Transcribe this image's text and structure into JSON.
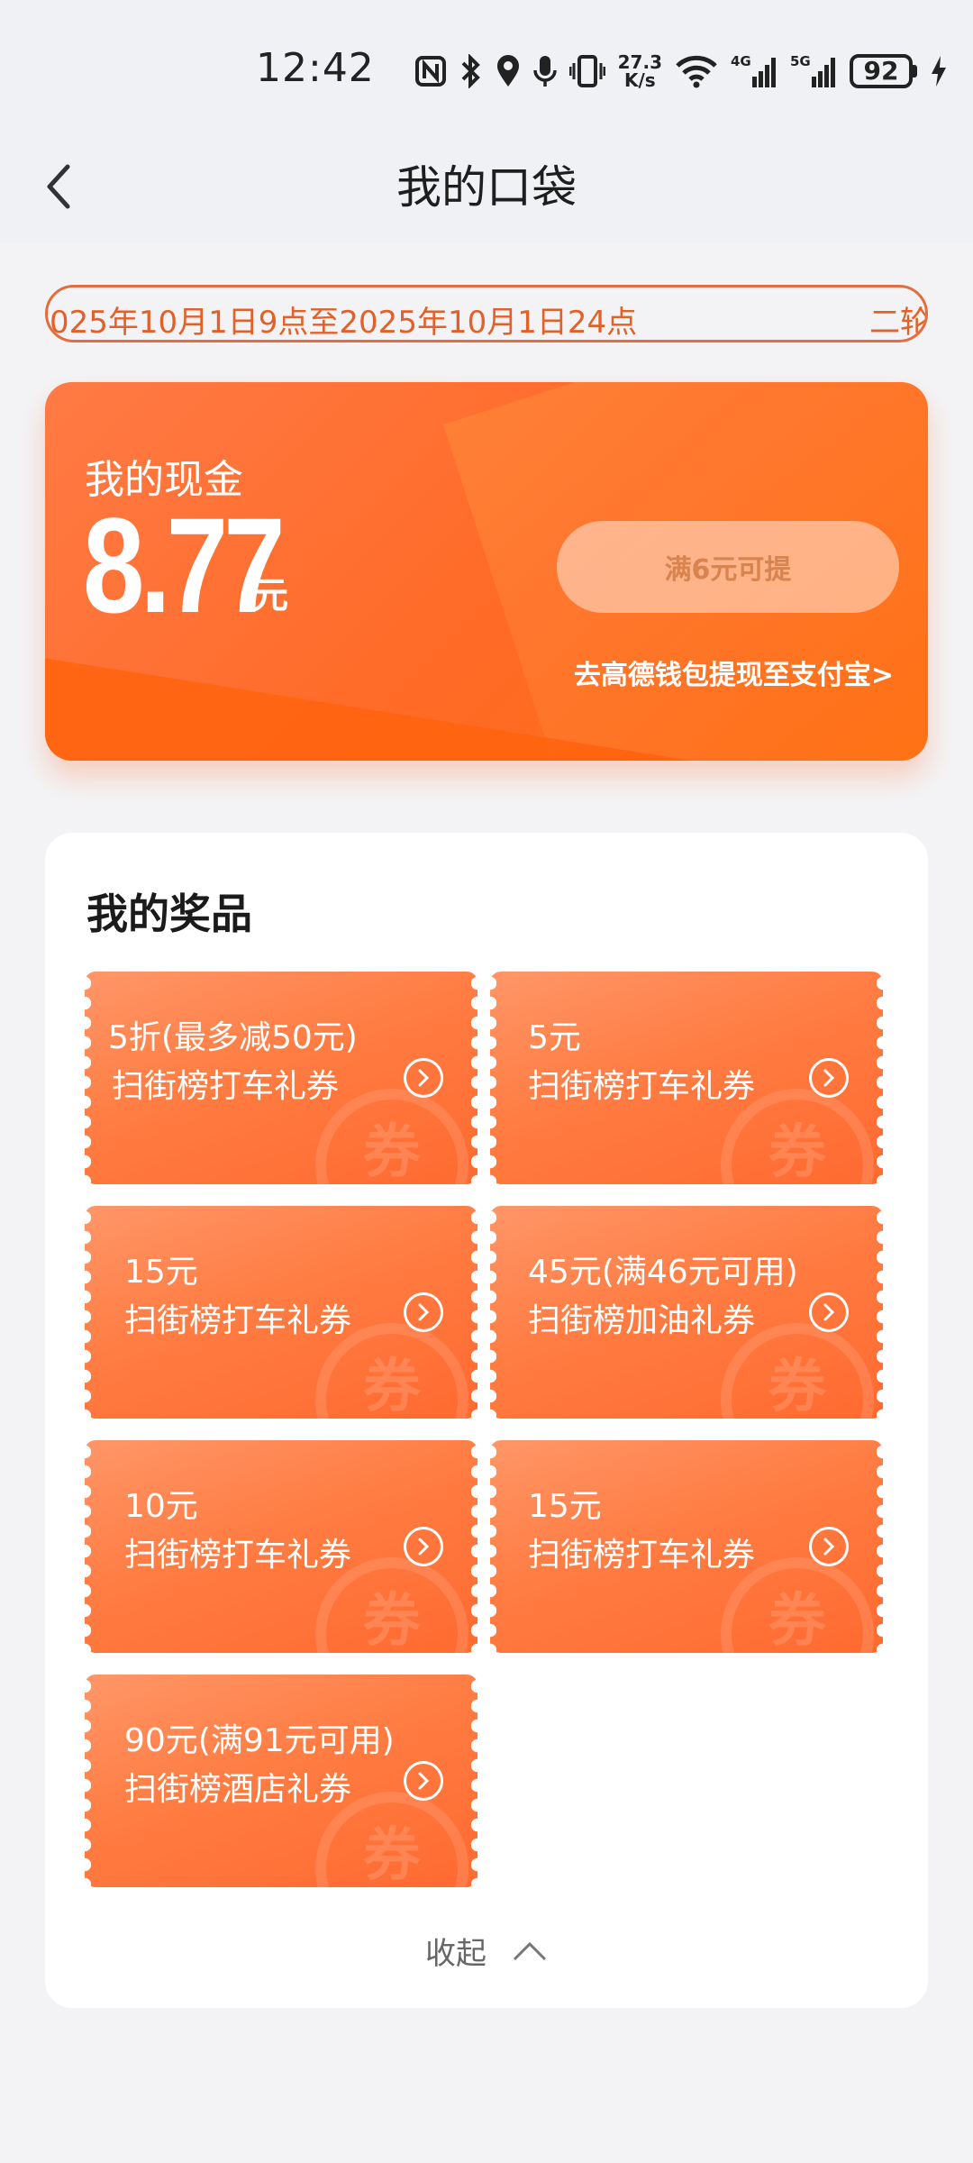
{
  "status_bar": {
    "time": "12:42",
    "net_speed_value": "27.3",
    "net_speed_unit": "K/s",
    "battery": "92",
    "icons": [
      "nfc-icon",
      "bluetooth-icon",
      "location-icon",
      "mic-icon",
      "vibrate-icon",
      "wifi-icon",
      "signal-4g-icon",
      "signal-5g-icon",
      "charging-icon"
    ]
  },
  "nav": {
    "title": "我的口袋",
    "back_icon": "chevron-left-icon"
  },
  "notice": {
    "text": "025年10月1日9点至2025年10月1日24点",
    "text_next": "二轮"
  },
  "cash": {
    "label": "我的现金",
    "amount": "8.77",
    "unit": "元",
    "withdraw_button": "满6元可提",
    "wallet_link": "去高德钱包提现至支付宝>"
  },
  "prizes": {
    "title": "我的奖品",
    "watermark": "券",
    "items": [
      {
        "amount": "5折(最多减50元)",
        "type": "扫街榜打车礼券"
      },
      {
        "amount": "5元",
        "type": "扫街榜打车礼券"
      },
      {
        "amount": "15元",
        "type": "扫街榜打车礼券"
      },
      {
        "amount": "45元(满46元可用)",
        "type": "扫街榜加油礼券"
      },
      {
        "amount": "10元",
        "type": "扫街榜打车礼券"
      },
      {
        "amount": "15元",
        "type": "扫街榜打车礼券"
      },
      {
        "amount": "90元(满91元可用)",
        "type": "扫街榜酒店礼券"
      }
    ],
    "collapse_label": "收起"
  },
  "colors": {
    "accent": "#ff6a26",
    "notice": "#e2612a"
  }
}
